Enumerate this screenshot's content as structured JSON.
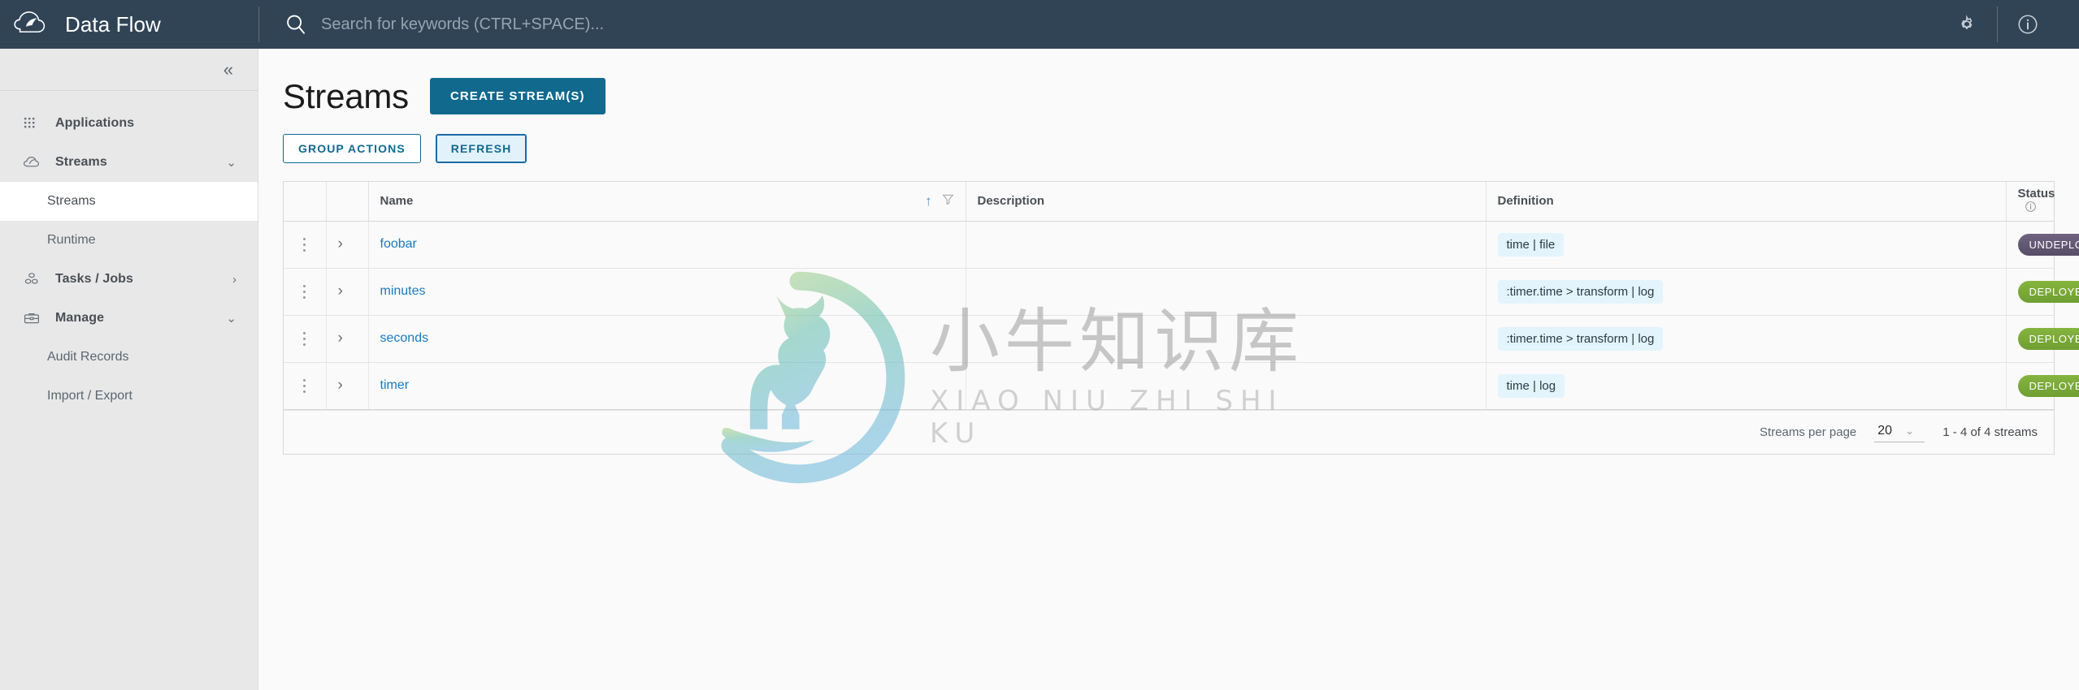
{
  "header": {
    "brand_title": "Data Flow",
    "logo_icon": "spring-cloud-logo-icon",
    "search": {
      "placeholder": "Search for keywords (CTRL+SPACE)...",
      "value": "",
      "icon": "search-icon"
    },
    "settings_icon": "gear-icon",
    "about_icon": "info-circle-icon"
  },
  "sidebar": {
    "collapse_icon": "chevron-double-left-icon",
    "collapse_label": "«",
    "items": [
      {
        "label": "Applications",
        "icon": "grid-dots-icon",
        "caret": "",
        "active": false
      },
      {
        "label": "Streams",
        "icon": "streams-cloud-icon",
        "caret": "⌄",
        "active": false
      },
      {
        "label": "Tasks / Jobs",
        "icon": "tasks-icon",
        "caret": "›",
        "active": false
      },
      {
        "label": "Manage",
        "icon": "briefcase-icon",
        "caret": "⌄",
        "active": false
      }
    ],
    "streams_children": [
      {
        "label": "Streams",
        "active": true
      },
      {
        "label": "Runtime",
        "active": false
      }
    ],
    "manage_children": [
      {
        "label": "Audit Records",
        "active": false
      },
      {
        "label": "Import / Export",
        "active": false
      }
    ]
  },
  "page": {
    "title": "Streams",
    "create_button": "CREATE STREAM(S)",
    "group_actions_button": "GROUP ACTIONS",
    "refresh_button": "REFRESH"
  },
  "table": {
    "columns": {
      "name": "Name",
      "description": "Description",
      "definition": "Definition",
      "status": "Status"
    },
    "name_sort_icon": "sort-ascending-icon",
    "name_sort_glyph": "↑",
    "name_filter_icon": "filter-icon",
    "status_info_icon": "info-circle-icon",
    "row_menu_icon": "kebab-menu-icon",
    "row_expand_icon": "chevron-right-icon",
    "row_expand_glyph": "›",
    "rows": [
      {
        "name": "foobar",
        "description": "",
        "definition": "time | file",
        "status": "UNDEPLOYED",
        "status_kind": "undeployed"
      },
      {
        "name": "minutes",
        "description": "",
        "definition": ":timer.time > transform | log",
        "status": "DEPLOYED",
        "status_kind": "deployed"
      },
      {
        "name": "seconds",
        "description": "",
        "definition": ":timer.time > transform | log",
        "status": "DEPLOYED",
        "status_kind": "deployed"
      },
      {
        "name": "timer",
        "description": "",
        "definition": "time | log",
        "status": "DEPLOYED",
        "status_kind": "deployed"
      }
    ]
  },
  "pagination": {
    "per_page_label": "Streams per page",
    "per_page_value": "20",
    "per_page_caret": "⌄",
    "range_text": "1 - 4 of 4 streams"
  },
  "watermark": {
    "chinese": "小牛知识库",
    "pinyin": "XIAO NIU ZHI SHI KU",
    "logo_icon": "deer-ring-logo-icon"
  },
  "colors": {
    "header_bg": "#314456",
    "sidebar_bg": "#e8e8e8",
    "primary": "#11698e",
    "link": "#1a7abf",
    "definition_pill_bg": "#e3f4fc",
    "deployed": "#7ba83a",
    "undeployed": "#61566f"
  }
}
